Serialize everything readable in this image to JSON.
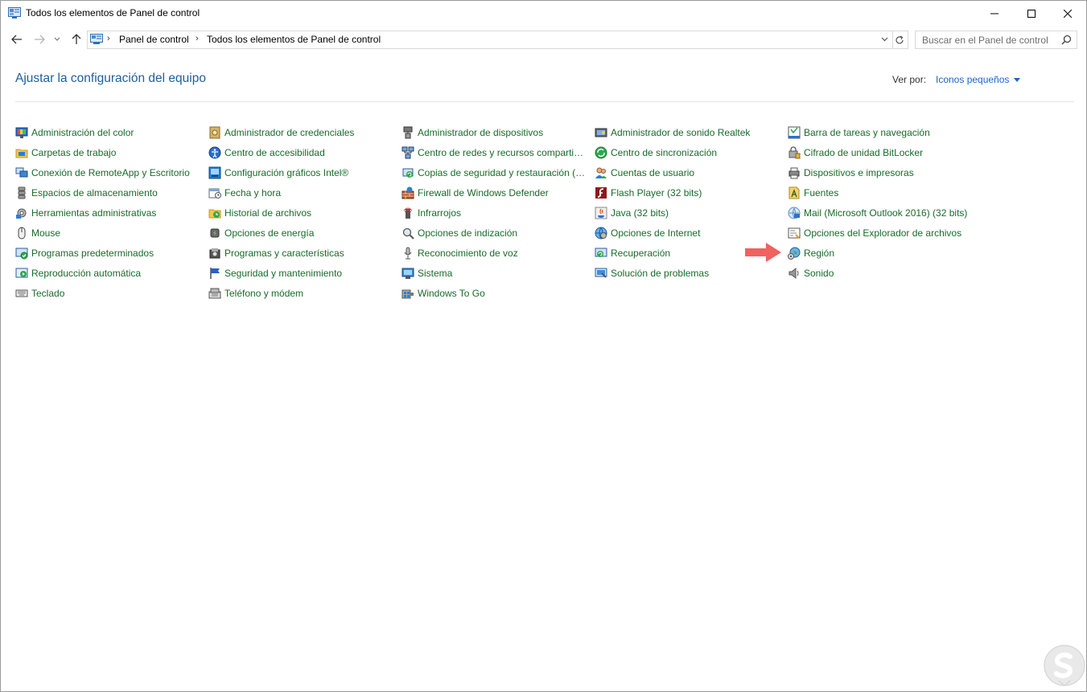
{
  "window": {
    "title": "Todos los elementos de Panel de control",
    "controls": {
      "minimize": "minimize-icon",
      "maximize": "maximize-icon",
      "close": "close-icon"
    }
  },
  "address_bar": {
    "crumbs": [
      "Panel de control",
      "Todos los elementos de Panel de control"
    ]
  },
  "search": {
    "placeholder": "Buscar en el Panel de control"
  },
  "header": {
    "title": "Ajustar la configuración del equipo",
    "view_by_label": "Ver por:",
    "view_by_value": "Iconos pequeños"
  },
  "columns": [
    [
      {
        "label": "Administración del color",
        "icon": "color-monitor-icon"
      },
      {
        "label": "Carpetas de trabajo",
        "icon": "work-folders-icon"
      },
      {
        "label": "Conexión de RemoteApp y Escritorio",
        "icon": "remote-desktop-icon"
      },
      {
        "label": "Espacios de almacenamiento",
        "icon": "storage-spaces-icon"
      },
      {
        "label": "Herramientas administrativas",
        "icon": "admin-tools-icon"
      },
      {
        "label": "Mouse",
        "icon": "mouse-icon"
      },
      {
        "label": "Programas predeterminados",
        "icon": "default-programs-icon"
      },
      {
        "label": "Reproducción automática",
        "icon": "autoplay-icon"
      },
      {
        "label": "Teclado",
        "icon": "keyboard-icon"
      }
    ],
    [
      {
        "label": "Administrador de credenciales",
        "icon": "credential-manager-icon"
      },
      {
        "label": "Centro de accesibilidad",
        "icon": "accessibility-icon"
      },
      {
        "label": "Configuración gráficos Intel®",
        "icon": "intel-graphics-icon"
      },
      {
        "label": "Fecha y hora",
        "icon": "date-time-icon"
      },
      {
        "label": "Historial de archivos",
        "icon": "file-history-icon"
      },
      {
        "label": "Opciones de energía",
        "icon": "power-options-icon"
      },
      {
        "label": "Programas y características",
        "icon": "programs-features-icon"
      },
      {
        "label": "Seguridad y mantenimiento",
        "icon": "security-flag-icon"
      },
      {
        "label": "Teléfono y módem",
        "icon": "phone-modem-icon"
      }
    ],
    [
      {
        "label": "Administrador de dispositivos",
        "icon": "device-manager-icon"
      },
      {
        "label": "Centro de redes y recursos comparti…",
        "icon": "network-center-icon"
      },
      {
        "label": "Copias de seguridad y restauración (…",
        "icon": "backup-restore-icon"
      },
      {
        "label": "Firewall de Windows Defender",
        "icon": "firewall-icon"
      },
      {
        "label": "Infrarrojos",
        "icon": "infrared-icon"
      },
      {
        "label": "Opciones de indización",
        "icon": "indexing-options-icon"
      },
      {
        "label": "Reconocimiento de voz",
        "icon": "microphone-icon"
      },
      {
        "label": "Sistema",
        "icon": "system-icon"
      },
      {
        "label": "Windows To Go",
        "icon": "windows-to-go-icon"
      }
    ],
    [
      {
        "label": "Administrador de sonido Realtek",
        "icon": "realtek-audio-icon"
      },
      {
        "label": "Centro de sincronización",
        "icon": "sync-center-icon"
      },
      {
        "label": "Cuentas de usuario",
        "icon": "user-accounts-icon"
      },
      {
        "label": "Flash Player (32 bits)",
        "icon": "flash-player-icon"
      },
      {
        "label": "Java (32 bits)",
        "icon": "java-icon"
      },
      {
        "label": "Opciones de Internet",
        "icon": "internet-options-icon"
      },
      {
        "label": "Recuperación",
        "icon": "recovery-icon"
      },
      {
        "label": "Solución de problemas",
        "icon": "troubleshooting-icon"
      }
    ],
    [
      {
        "label": "Barra de tareas y navegación",
        "icon": "taskbar-icon"
      },
      {
        "label": "Cifrado de unidad BitLocker",
        "icon": "bitlocker-icon"
      },
      {
        "label": "Dispositivos e impresoras",
        "icon": "devices-printers-icon"
      },
      {
        "label": "Fuentes",
        "icon": "fonts-icon"
      },
      {
        "label": "Mail (Microsoft Outlook 2016) (32 bits)",
        "icon": "mail-icon"
      },
      {
        "label": "Opciones del Explorador de archivos",
        "icon": "explorer-options-icon"
      },
      {
        "label": "Región",
        "icon": "region-globe-icon"
      },
      {
        "label": "Sonido",
        "icon": "speaker-icon"
      }
    ]
  ],
  "annotation": {
    "arrow_color": "#f0625f",
    "arrow_icon": "right-arrow-icon"
  },
  "colors": {
    "heading": "#1e5e9e",
    "item_text": "#1a6a2a",
    "link": "#1e64c8"
  }
}
